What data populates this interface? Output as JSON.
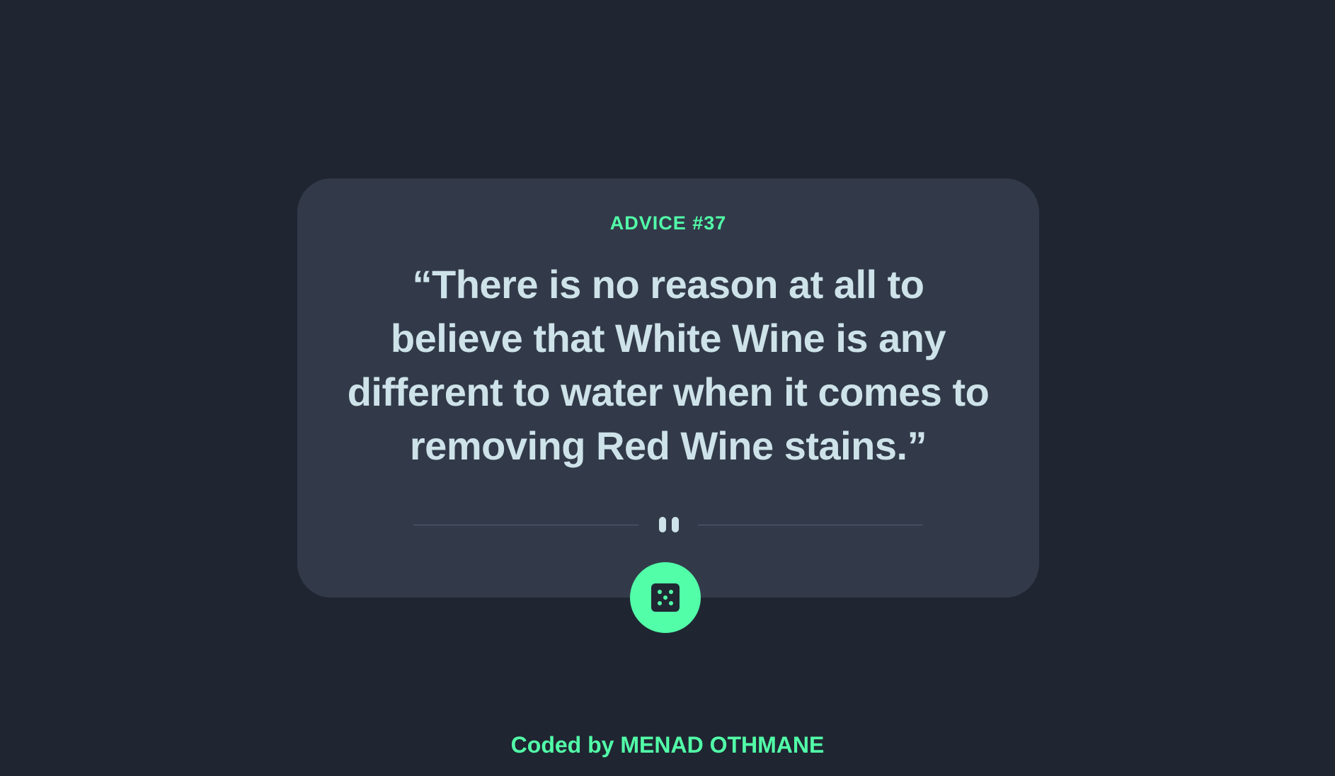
{
  "card": {
    "advice_id": "ADVICE #37",
    "advice_text": "“There is no reason at all to believe that White Wine is any different to water when it comes to removing Red Wine stains.”",
    "divider_icon": "pause-quote-icon"
  },
  "dice_button": {
    "icon": "dice-icon"
  },
  "footer": {
    "credit": "Coded by MENAD OTHMANE"
  },
  "colors": {
    "background": "#1f2632",
    "card": "#323a4a",
    "accent": "#52ffa8",
    "text": "#cee3e9"
  }
}
